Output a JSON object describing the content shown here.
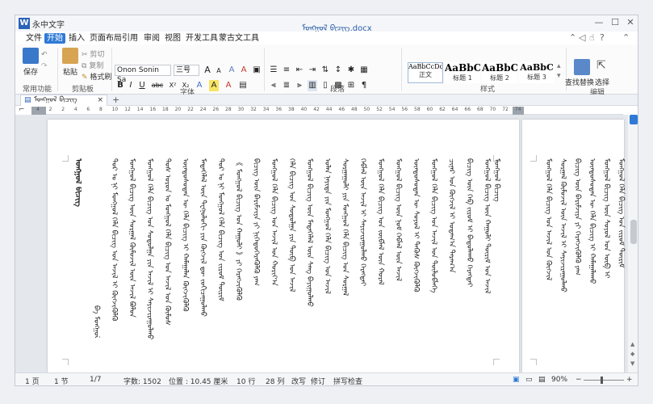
{
  "app": {
    "logo_letter": "W",
    "name": "永中文字",
    "doc_title": "ᠮᠣᠩᠭᠣᠯ ᠪᠢᠴᠢᠭ.docx"
  },
  "window_controls": {
    "minimize": "—",
    "maximize": "☐",
    "close": "✕"
  },
  "menu": [
    {
      "label": "文件",
      "active": false
    },
    {
      "label": "开始",
      "active": true
    },
    {
      "label": "插入",
      "active": false
    },
    {
      "label": "页面布局",
      "active": false
    },
    {
      "label": "引用",
      "active": false
    },
    {
      "label": "审阅",
      "active": false
    },
    {
      "label": "视图",
      "active": false
    },
    {
      "label": "开发工具",
      "active": false
    },
    {
      "label": "蒙古文工具",
      "active": false
    }
  ],
  "menu_right_icons": [
    "chevron-up-icon",
    "share-icon",
    "thumbs-up-icon",
    "help-icon",
    "chevron-up-small-icon"
  ],
  "ribbon": {
    "common": {
      "save": "保存",
      "group": "常用功能"
    },
    "clipboard": {
      "paste": "粘贴",
      "cut": "剪切",
      "copy": "复制",
      "format_painter": "格式刷",
      "group": "剪贴板"
    },
    "font": {
      "name": "Onon Sonin Sa",
      "size": "三号",
      "grow": "A",
      "shrink": "A",
      "bold": "B",
      "italic": "I",
      "underline": "U",
      "strike": "abc",
      "superscript": "X²",
      "subscript": "X₂",
      "clear": "A",
      "highlight": "A",
      "color": "A",
      "group": "字体"
    },
    "paragraph": {
      "group": "段落"
    },
    "styles": {
      "items": [
        {
          "sample": "AaBbCcDd",
          "name": "正文"
        },
        {
          "sample": "AaBbC",
          "name": "标题 1"
        },
        {
          "sample": "AaBbC",
          "name": "标题 2"
        },
        {
          "sample": "AaBbC",
          "name": "标题 3"
        }
      ],
      "group": "样式"
    },
    "editing": {
      "find_replace": "查找替换",
      "select": "选择",
      "group": "编辑"
    }
  },
  "doc_tab": {
    "label": "ᠮᠣᠩᠭᠣᠯ ᠪᠢᠴᠢᠭ",
    "close": "×",
    "new": "+"
  },
  "ruler_numbers": [
    "4",
    "2",
    "2",
    "4",
    "6",
    "8",
    "10",
    "12",
    "14",
    "16",
    "18",
    "20",
    "22",
    "24",
    "26",
    "28",
    "30",
    "32",
    "34",
    "36",
    "38",
    "40",
    "42",
    "44",
    "46",
    "48",
    "50",
    "52",
    "54",
    "56",
    "58",
    "60",
    "62",
    "64",
    "66",
    "68",
    "70",
    "72",
    "74"
  ],
  "page1_columns": [
    "ᠮᠣᠩᠭᠣᠯ ᠪᠢᠴᠢᠭ",
    "ᠪᠠ ᠮᠣᠩᠭᠣᠯ",
    "ᠲᠤᠷ ᠤ ᠨᠢ ᠮᠣᠩᠭᠣᠯ ᠬᠡᠯᠡ ᠪᠢᠴᠢᠭ ᠤᠨ ᠠᠵᠢᠯ ᠢ ᠬᠥᠭᠵᠢᠭᠦᠯᠬᠦ",
    "ᠮᠣᠩᠭᠣᠯ ᠪᠢᠴᠢᠭ ᠦᠨ ᠰᠤᠷᠭᠠᠯ ᠬᠦᠮᠦᠵᠢᠯ ᠦᠨ ᠠᠵᠢᠯ ᠪᠣᠯᠤᠨ",
    "ᠮᠣᠩᠭᠣᠯ ᠬᠡᠯᠡ ᠪᠢᠴᠢᠭ ᠤᠨ ᠰᠤᠳᠤᠯᠭᠠ ᠶᠢᠨ ᠠᠵᠢᠯ ᠢ ᠰᠠᠶᠢᠵᠢᠷᠠᠭᠤᠯᠬᠤ",
    "ᠲᠤᠰ ᠣᠷᠣᠨ ᠤ ᠮᠣᠩᠭᠣᠯ ᠬᠡᠯᠡ ᠪᠢᠴᠢᠭ ᠤᠨ ᠠᠵᠢᠯ ᠤᠨ ᠬᠦᠮᠦᠰ",
    "ᠦᠨᠳᠦᠰᠦᠲᠡᠨ ᠦ ᠬᠡᠯᠡ ᠪᠢᠴᠢᠭ ᠢ ᠬᠠᠮᠠᠭᠠᠯᠠᠨ ᠬᠥᠭᠵᠢᠭᠦᠯᠬᠦ",
    "ᠮᠡᠳᠡᠭᠡᠯᠡᠯ ᠦᠨ ᠲᠧᠬᠨᠣᠯᠤᠭᠢ ᠶᠢᠨ ᠬᠥᠭᠵᠢᠯ ᠳᠦ ᠵᠣᠬᠢᠴᠠᠭᠤᠯᠬᠤ",
    "ᠲᠤᠷ ᠤ ᠨᠢ ᠮᠣᠩᠭᠣᠯ ᠬᠡᠯᠡ ᠪᠢᠴᠢᠭ ᠤᠨ ᠵᠢᠷᠤᠮ ᠳᠦᠷᠢᠮ",
    "《 ᠮᠣᠩᠭᠣᠯ ᠪᠢᠴᠢᠭ ᠤᠨ ᠬᠠᠭᠤᠯᠢ 》ᠶᠢ ᠬᠡᠷᠡᠭᠵᠢᠭᠦᠯᠬᠦ",
    "ᠪᠢᠴᠢᠭ ᠦᠨ ᠪᠠᠷᠢᠮᠵᠢᠶᠠ ᠶᠢ ᠨᠢᠭᠡᠳᠦᠭᠡᠷᠡᠭᠦᠯᠬᠦ ᠶᠠᠭ",
    "ᠮᠣᠩᠭᠣᠯ ᠬᠡᠯᠡ ᠪᠢᠴᠢᠭ ᠤᠨ ᠠᠵᠢᠯ ᠤᠨ ᠬᠣᠷᠢᠶ᠎ᠠ",
    "ᠬᠡᠯᠡ ᠪᠢᠴᠢᠭ ᠤᠨ ᠰᠤᠳᠤᠯᠭᠠ ᠶᠢᠨ ᠲᠥᠪ ᠤᠨ ᠠᠵᠢᠯ",
    "ᠮᠣᠩᠭᠣᠯ ᠪᠢᠴᠢᠭ ᠦᠨ ᠮᠡᠳᠡᠭᠡᠯᠡᠯ ᠦᠨ ᠰᠠᠩ ᠪᠠᠶᠢᠭᠤᠯᠬᠤ",
    "ᠣᠯᠠᠨ ᠨᠡᠶᠢᠲᠡ ᠶᠢᠨ ᠮᠣᠩᠭᠣᠯ ᠬᠡᠯᠡ ᠪᠢᠴᠢᠭ ᠤᠨ ᠠᠵᠢᠯ",
    "ᠰᠤᠷᠭᠠᠭᠤᠯᠢ ᠶᠢᠨ ᠮᠣᠩᠭᠣᠯ ᠬᠡᠯᠡ ᠪᠢᠴᠢᠭ ᠤᠨ ᠰᠤᠷᠭᠠᠯ",
    "ᠬᠡᠪᠯᠡᠯ ᠦᠨ ᠠᠵᠢᠯ ᠢ ᠰᠠᠶᠢᠵᠢᠷᠠᠭᠤᠯᠬᠤ ᠬᠡᠷᠡᠭᠲᠡᠶ",
    "ᠮᠣᠩᠭᠣᠯ ᠬᠡᠯᠡ ᠪᠢᠴᠢᠭ ᠤᠨ ᠵᠥᠪᠯᠡᠯ ᠦᠨ ᠬᠤᠷᠠᠯ",
    "ᠮᠣᠩᠭᠣᠯ ᠪᠢᠴᠢᠭ ᠦᠨ ᠨᠤᠮ ᠬᠡᠪᠯᠡᠯ ᠦᠨ ᠠᠵᠢᠯ",
    "ᠦᠨᠳᠦᠰᠦᠲᠡᠨ ᠦ ᠰᠣᠶᠣᠯ ᠢ ᠲᠡᠭᠦᠰ ᠬᠥᠭᠵᠢᠭᠦᠯᠬᠦ",
    "ᠮᠣᠩᠭᠣᠯ ᠬᠡᠯᠡ ᠪᠢᠴᠢᠭ ᠤᠨ ᠠᠵᠢᠯ ᠤᠨ ᠲᠥᠯᠥᠪᠯᠡᠭᠡ",
    "ᠴᠢᠨᠠᠷ ᠤᠨ ᠬᠥᠭᠵᠢᠯ ᠢ ᠤᠳᠠᠭ᠎ᠠ ᠳᠠᠷᠠᠭ᠎ᠠ",
    "ᠪᠢᠴᠢᠭ ᠦᠨ ᠬᠡᠪ ᠵᠢᠷᠤᠮ ᠢ ᠪᠠᠲᠤᠯᠠᠬᠤ ᠬᠡᠷᠡᠭᠲᠡᠶ",
    "ᠮᠣᠩᠭᠣᠯ ᠪᠢᠴᠢᠭ ᠦᠨ ᠬᠠᠭᠤᠯᠢ ᠳᠦᠷᠢᠮ ᠤᠨ ᠠᠵᠢᠯ",
    "ᠮᠣᠩᠭᠣᠯ ᠪᠢᠴᠢᠭ"
  ],
  "page2_columns": [
    "ᠮᠣᠩᠭᠣᠯ ᠬᠡᠯᠡ ᠪᠢᠴᠢᠭ ᠤᠨ ᠠᠵᠢᠯ ᠤᠨ ᠬᠥᠭᠵᠢᠯ",
    "ᠰᠤᠷᠭᠠᠯ ᠬᠦᠮᠦᠵᠢᠯ ᠦᠨ ᠠᠵᠢᠯ ᠢ ᠰᠠᠶᠢᠵᠢᠷᠠᠭᠤᠯᠬᠤ",
    "ᠪᠢᠴᠢᠭ ᠦᠨ ᠪᠠᠷᠢᠮᠵᠢᠶᠠ ᠶᠢ ᠬᠡᠷᠡᠭᠵᠢᠭᠦᠯᠬᠦ ᠶᠠᠭ",
    "ᠦᠨᠳᠦᠰᠦᠲᠡᠨ ᠦ ᠬᠡᠯᠡ ᠪᠢᠴᠢᠭ ᠢ ᠬᠠᠮᠠᠭᠠᠯᠠᠬᠤ",
    "ᠮᠣᠩᠭᠣᠯ ᠪᠢᠴᠢᠭ ᠦᠨ ᠰᠣᠶᠣᠯ ᠤᠨ ᠥᠪ ᠢ",
    "ᠮᠣᠩᠭᠣᠯ ᠬᠡᠯᠡ ᠪᠢᠴᠢᠭ ᠤᠨ ᠵᠢᠷᠤᠮ ᠳᠦᠷᠢᠮ"
  ],
  "status": {
    "page": "1 页",
    "section": "1 节",
    "pages": "1/7",
    "word_count": "字数: 1502",
    "position": "位置 : 10.45 厘米",
    "line": "10 行",
    "column": "28 列",
    "track": "改写",
    "revise": "修订",
    "spell": "拼写检查",
    "zoom": "90%",
    "zoom_out": "−",
    "zoom_in": "+"
  }
}
